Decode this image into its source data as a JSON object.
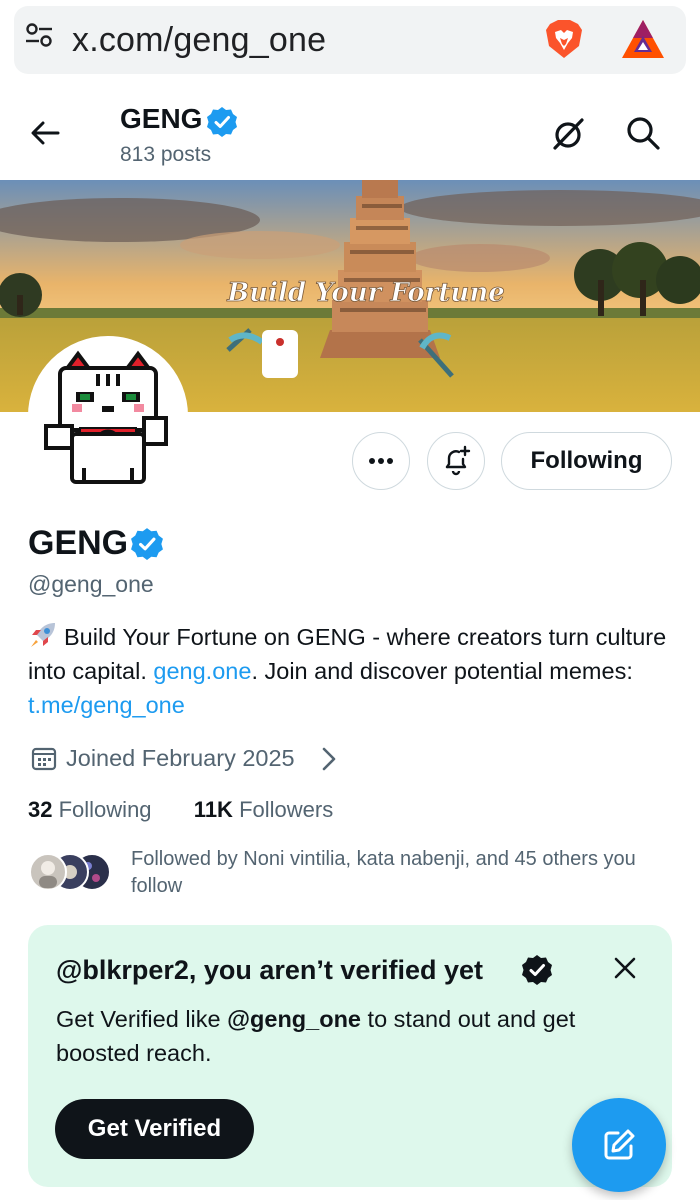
{
  "browser": {
    "url": "x.com/geng_one"
  },
  "header": {
    "name": "GENG",
    "posts": "813 posts"
  },
  "banner": {
    "caption": "Build Your Fortune"
  },
  "actions": {
    "follow_label": "Following"
  },
  "profile": {
    "name": "GENG",
    "handle": "@geng_one",
    "bio_1": "Build Your Fortune on GENG  - where creators turn culture into capital. ",
    "bio_link_1": "geng.one",
    "bio_2": ". Join and discover potential memes: ",
    "bio_link_2": "t.me/geng_one",
    "joined": "Joined February 2025",
    "following_count": "32",
    "following_label": "Following",
    "followers_count": "11K",
    "followers_label": "Followers",
    "followed_by": "Followed by Noni vintilia, kata nabenji, and 45 others you follow"
  },
  "verify_card": {
    "title": "@blkrper2, you aren’t verified yet",
    "body_1": "Get Verified like ",
    "body_handle": "@geng_one",
    "body_2": " to stand out and get boosted reach.",
    "button": "Get Verified"
  },
  "colors": {
    "accent": "#1d9bf0",
    "text": "#0f1419",
    "muted": "#536471",
    "card": "#def8ec"
  },
  "icons": [
    "tune-icon",
    "brave-icon",
    "bat-icon",
    "back-icon",
    "verified-badge-icon",
    "grok-icon",
    "search-icon",
    "more-icon",
    "bell-plus-icon",
    "calendar-icon",
    "chevron-right-icon",
    "close-icon",
    "compose-icon",
    "rocket-icon"
  ]
}
